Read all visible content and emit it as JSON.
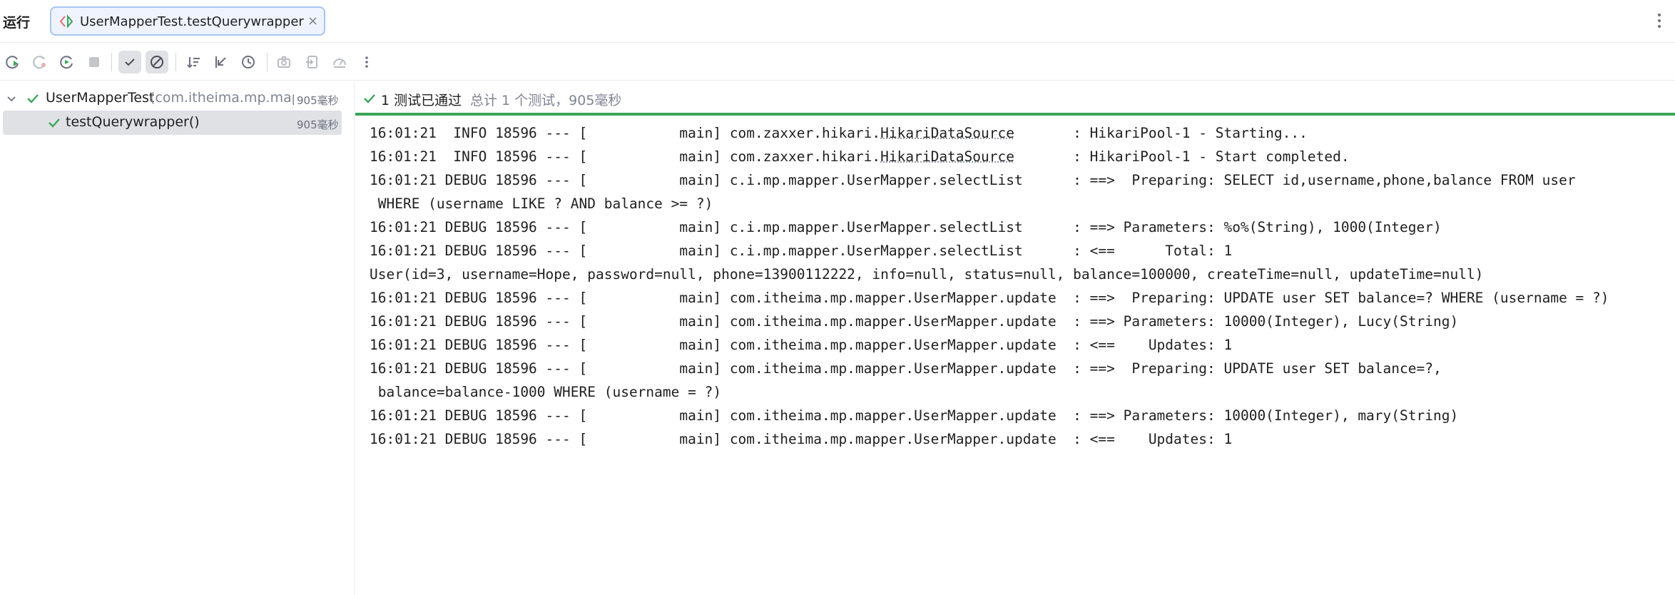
{
  "topbar": {
    "title": "运行",
    "tab_label": "UserMapperTest.testQuerywrapper",
    "tab_close": "×"
  },
  "toolbar": {
    "icons": [
      "rerun-icon",
      "rerun-failed-icon",
      "rerun-auto-icon",
      "stop-icon",
      "show-passed-icon",
      "show-ignored-icon",
      "sort-icon",
      "collapse-icon",
      "history-icon",
      "screenshot-icon",
      "export-icon",
      "coverage-icon",
      "more-icon"
    ]
  },
  "tree": {
    "root": {
      "name": "UserMapperTest",
      "package": "(com.itheima.mp.mapp",
      "time": "905毫秒"
    },
    "child": {
      "name": "testQuerywrapper()",
      "time": "905毫秒"
    }
  },
  "status": {
    "passed": "1 测试已通过",
    "total": "总计 1 个测试，905毫秒"
  },
  "colors": {
    "passed": "#3aa559",
    "selection": "#dfe1e5",
    "tab_border": "#a8c4f0"
  },
  "console": {
    "lines": [
      {
        "pre": "16:01:21  INFO 18596 --- [           main] com.zaxxer.hikari.",
        "link": "HikariDataSource",
        "post": "       : HikariPool-1 - Starting..."
      },
      {
        "pre": "16:01:21  INFO 18596 --- [           main] com.zaxxer.hikari.",
        "link": "HikariDataSource",
        "post": "       : HikariPool-1 - Start completed."
      },
      {
        "pre": "16:01:21 DEBUG 18596 --- [           main] c.i.mp.mapper.UserMapper.selectList      : ==>  Preparing: SELECT id,username,phone,balance FROM user",
        "link": "",
        "post": ""
      },
      {
        "pre": " WHERE (username LIKE ? AND balance >= ?)",
        "link": "",
        "post": ""
      },
      {
        "pre": "16:01:21 DEBUG 18596 --- [           main] c.i.mp.mapper.UserMapper.selectList      : ==> Parameters: %o%(String), 1000(Integer)",
        "link": "",
        "post": ""
      },
      {
        "pre": "16:01:21 DEBUG 18596 --- [           main] c.i.mp.mapper.UserMapper.selectList      : <==      Total: 1",
        "link": "",
        "post": ""
      },
      {
        "pre": "User(id=3, username=Hope, password=null, phone=13900112222, info=null, status=null, balance=100000, createTime=null, updateTime=null)",
        "link": "",
        "post": ""
      },
      {
        "pre": "16:01:21 DEBUG 18596 --- [           main] com.itheima.mp.mapper.UserMapper.update  : ==>  Preparing: UPDATE user SET balance=? WHERE (username = ?)",
        "link": "",
        "post": ""
      },
      {
        "pre": "16:01:21 DEBUG 18596 --- [           main] com.itheima.mp.mapper.UserMapper.update  : ==> Parameters: 10000(Integer), Lucy(String)",
        "link": "",
        "post": ""
      },
      {
        "pre": "16:01:21 DEBUG 18596 --- [           main] com.itheima.mp.mapper.UserMapper.update  : <==    Updates: 1",
        "link": "",
        "post": ""
      },
      {
        "pre": "16:01:21 DEBUG 18596 --- [           main] com.itheima.mp.mapper.UserMapper.update  : ==>  Preparing: UPDATE user SET balance=?,",
        "link": "",
        "post": ""
      },
      {
        "pre": " balance=balance-1000 WHERE (username = ?)",
        "link": "",
        "post": ""
      },
      {
        "pre": "16:01:21 DEBUG 18596 --- [           main] com.itheima.mp.mapper.UserMapper.update  : ==> Parameters: 10000(Integer), mary(String)",
        "link": "",
        "post": ""
      },
      {
        "pre": "16:01:21 DEBUG 18596 --- [           main] com.itheima.mp.mapper.UserMapper.update  : <==    Updates: 1",
        "link": "",
        "post": ""
      }
    ]
  }
}
